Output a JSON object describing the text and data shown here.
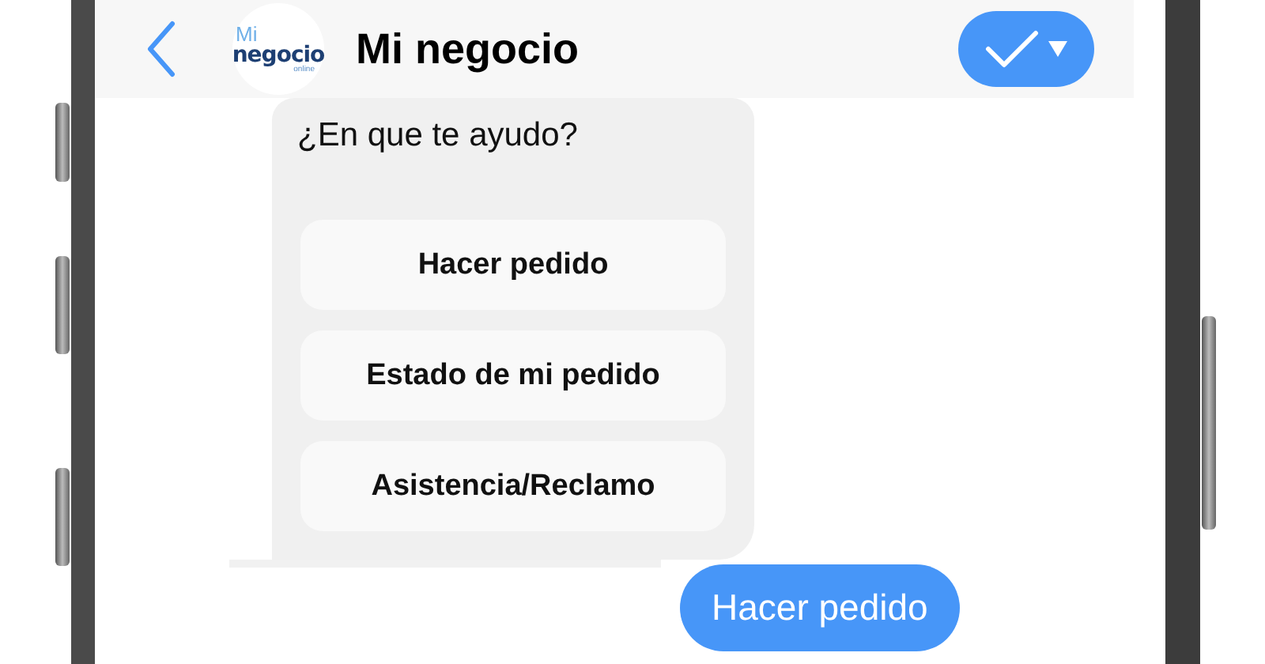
{
  "header": {
    "logo": {
      "line1": "Mi",
      "line2": "negocio",
      "line3": "online"
    },
    "title": "Mi negocio"
  },
  "messages": [
    {
      "kind": "bot",
      "text": "¿En que te ayudo?",
      "options": [
        "Hacer pedido",
        "Estado de mi pedido",
        "Asistencia/Reclamo"
      ]
    },
    {
      "kind": "user",
      "text": "Hacer pedido"
    }
  ]
}
